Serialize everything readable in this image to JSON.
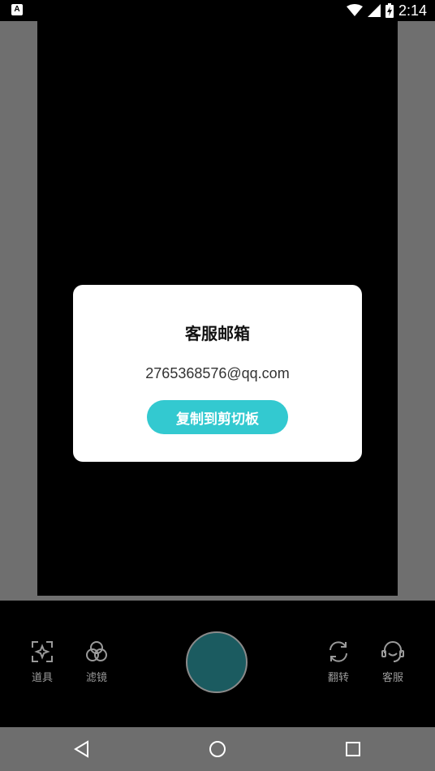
{
  "status_bar": {
    "time": "2:14",
    "app_icon_letter": "A"
  },
  "dialog": {
    "title": "客服邮箱",
    "email": "2765368576@qq.com",
    "copy_button_label": "复制到剪切板"
  },
  "toolbar": {
    "left_tools": [
      {
        "label": "道具",
        "icon": "props-icon"
      },
      {
        "label": "滤镜",
        "icon": "filter-icon"
      }
    ],
    "right_tools": [
      {
        "label": "翻转",
        "icon": "flip-camera-icon"
      },
      {
        "label": "客服",
        "icon": "customer-service-icon"
      }
    ]
  },
  "colors": {
    "accent": "#33c9d0",
    "shutter": "#1b5b60",
    "background": "#6f6f6f"
  }
}
